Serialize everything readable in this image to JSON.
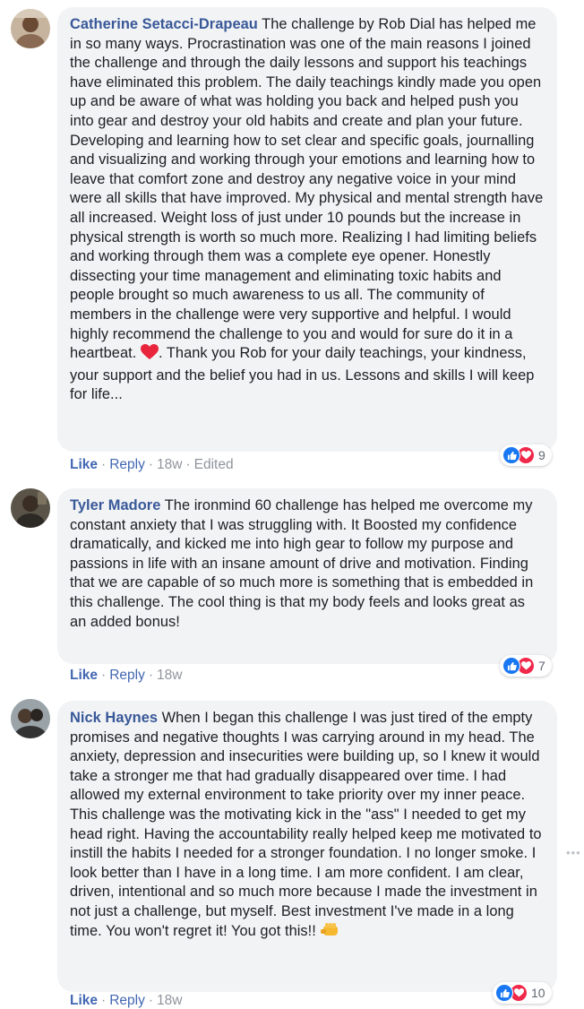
{
  "comments": [
    {
      "author": "Catherine Setacci-Drapeau",
      "text_before": "The challenge by Rob Dial has helped me in so many ways. Procrastination was one of the main reasons I joined the challenge and through the daily lessons and support his teachings have eliminated this problem. The daily teachings kindly made you open up and be aware of what was holding you back and helped push you into gear and destroy your old habits and create and plan your future. Developing and learning how to set clear and specific goals, journalling and visualizing and working through your emotions and learning how to leave that comfort zone and destroy any negative voice in your mind were all skills that have improved. My physical and mental strength have all increased. Weight loss of just under 10 pounds but the increase in physical strength is worth so much more. Realizing I had limiting beliefs and working through them was a complete eye opener. Honestly dissecting your time management and eliminating toxic habits and people brought so much awareness to us all. The community of members in the challenge were very supportive and helpful. I would highly recommend the challenge to you and would for sure do it in a heartbeat.",
      "text_after": ". Thank you Rob for your daily teachings, your kindness, your support and the belief you had in us. Lessons and skills I will keep for life...",
      "like_label": "Like",
      "reply_label": "Reply",
      "time": "18w",
      "edited": "Edited",
      "reaction_count": "9"
    },
    {
      "author": "Tyler Madore",
      "text": "The ironmind 60 challenge has helped me overcome my constant anxiety that I was struggling with. It Boosted my confidence dramatically, and kicked me into high gear to follow my purpose and passions in life with an insane amount of drive and motivation. Finding that we are capable of so much more is something that is embedded in this challenge. The cool thing is that my body feels and looks great as an added bonus!",
      "like_label": "Like",
      "reply_label": "Reply",
      "time": "18w",
      "reaction_count": "7"
    },
    {
      "author": "Nick Haynes",
      "text": "When I began this challenge I was just tired of the empty promises and negative thoughts I was carrying around in my head. The anxiety, depression and insecurities were building up, so I knew it would take a stronger me that had gradually disappeared over time. I had allowed my external environment to take priority over my inner peace. This challenge was the motivating kick in the \"ass\" I needed to get my head right. Having the accountability really helped keep me motivated to instill the habits I needed for a stronger foundation. I no longer smoke. I look better than I have in a long time. I am more confident. I am clear, driven, intentional and so much more because I made the investment in not just a challenge, but myself. Best investment I've made in a long time. You won't regret it! You got this!!",
      "like_label": "Like",
      "reply_label": "Reply",
      "time": "18w",
      "reaction_count": "10"
    }
  ],
  "icons": {
    "heart_emoji": "heart-emoji",
    "fist_emoji": "fist-emoji",
    "like_reaction": "thumbs-up-icon",
    "love_reaction": "heart-icon",
    "more_options": "more-options-icon"
  },
  "colors": {
    "author": "#385898",
    "link": "#4267b2",
    "bubble": "#f2f3f5",
    "meta": "#90949c",
    "like_blue": "#1877f2",
    "love_red": "#f0284a"
  }
}
